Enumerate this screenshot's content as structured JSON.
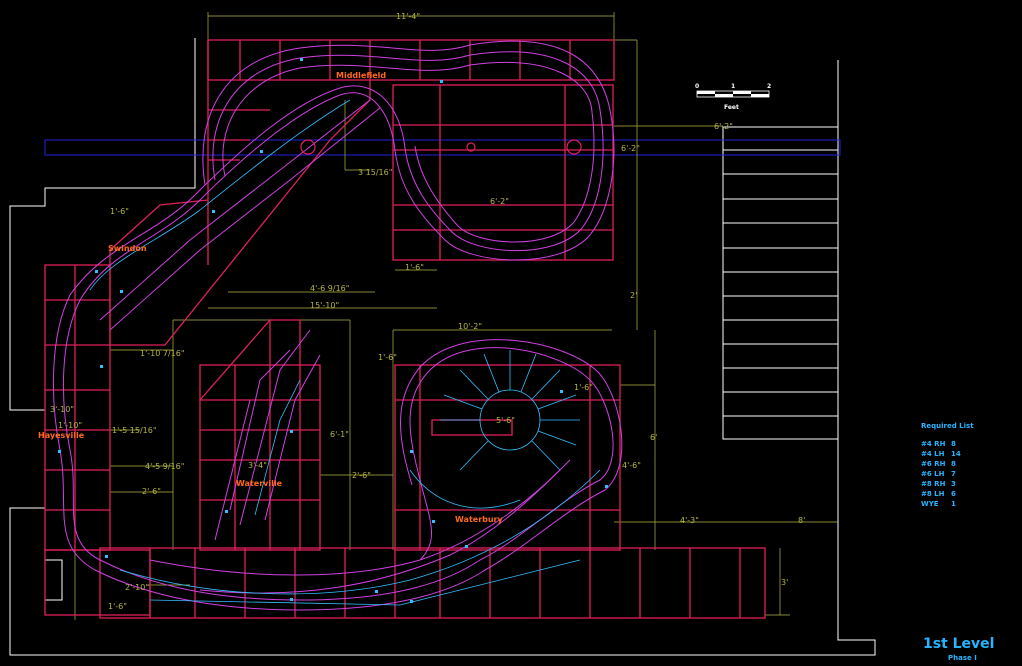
{
  "title": "1st Level",
  "subtitle": "Phase I",
  "scale_bar": {
    "ticks": [
      "0",
      "1",
      "2"
    ],
    "unit_label": "Feet"
  },
  "towns": [
    "Middlefield",
    "Swindon",
    "Hayesville",
    "Waterville",
    "Waterbury"
  ],
  "required_list": {
    "heading": "Required List",
    "items": [
      {
        "label": "#4 RH",
        "count": "8"
      },
      {
        "label": "#4 LH",
        "count": "14"
      },
      {
        "label": "#6 RH",
        "count": "8"
      },
      {
        "label": "#6 LH",
        "count": "7"
      },
      {
        "label": "#8 RH",
        "count": "3"
      },
      {
        "label": "#8 LH",
        "count": "6"
      },
      {
        "label": "WYE",
        "count": "1"
      }
    ]
  },
  "dimensions": [
    "11'-4\"",
    "6'-2\"",
    "6'-2\"",
    "6'-2\"",
    "3 15/16\"",
    "1'-6\"",
    "4'-6 9/16\"",
    "15'-10\"",
    "1'-10 7/16\"",
    "10'-2\"",
    "1'-6\"",
    "1'-5 15/16\"",
    "4'-5 9/16\"",
    "2'-6\"",
    "3'-4\"",
    "6'-1\"",
    "2'-6\"",
    "6'",
    "4'-6\"",
    "4'-3\"",
    "8'",
    "3'",
    "5'-6\"",
    "2'",
    "1'-6\"",
    "1'-6\"",
    "3'-10\"",
    "1'-10\"",
    "1'-6\"",
    "2'-10\""
  ],
  "colors": {
    "benchwork": "#e0205a",
    "track": "#d040e0",
    "track2": "#33bfff",
    "dimension": "#b5b545",
    "town": "#ff6a1a",
    "legend": "#27b4ff",
    "outline": "#ffffff",
    "band": "#2222dd"
  }
}
